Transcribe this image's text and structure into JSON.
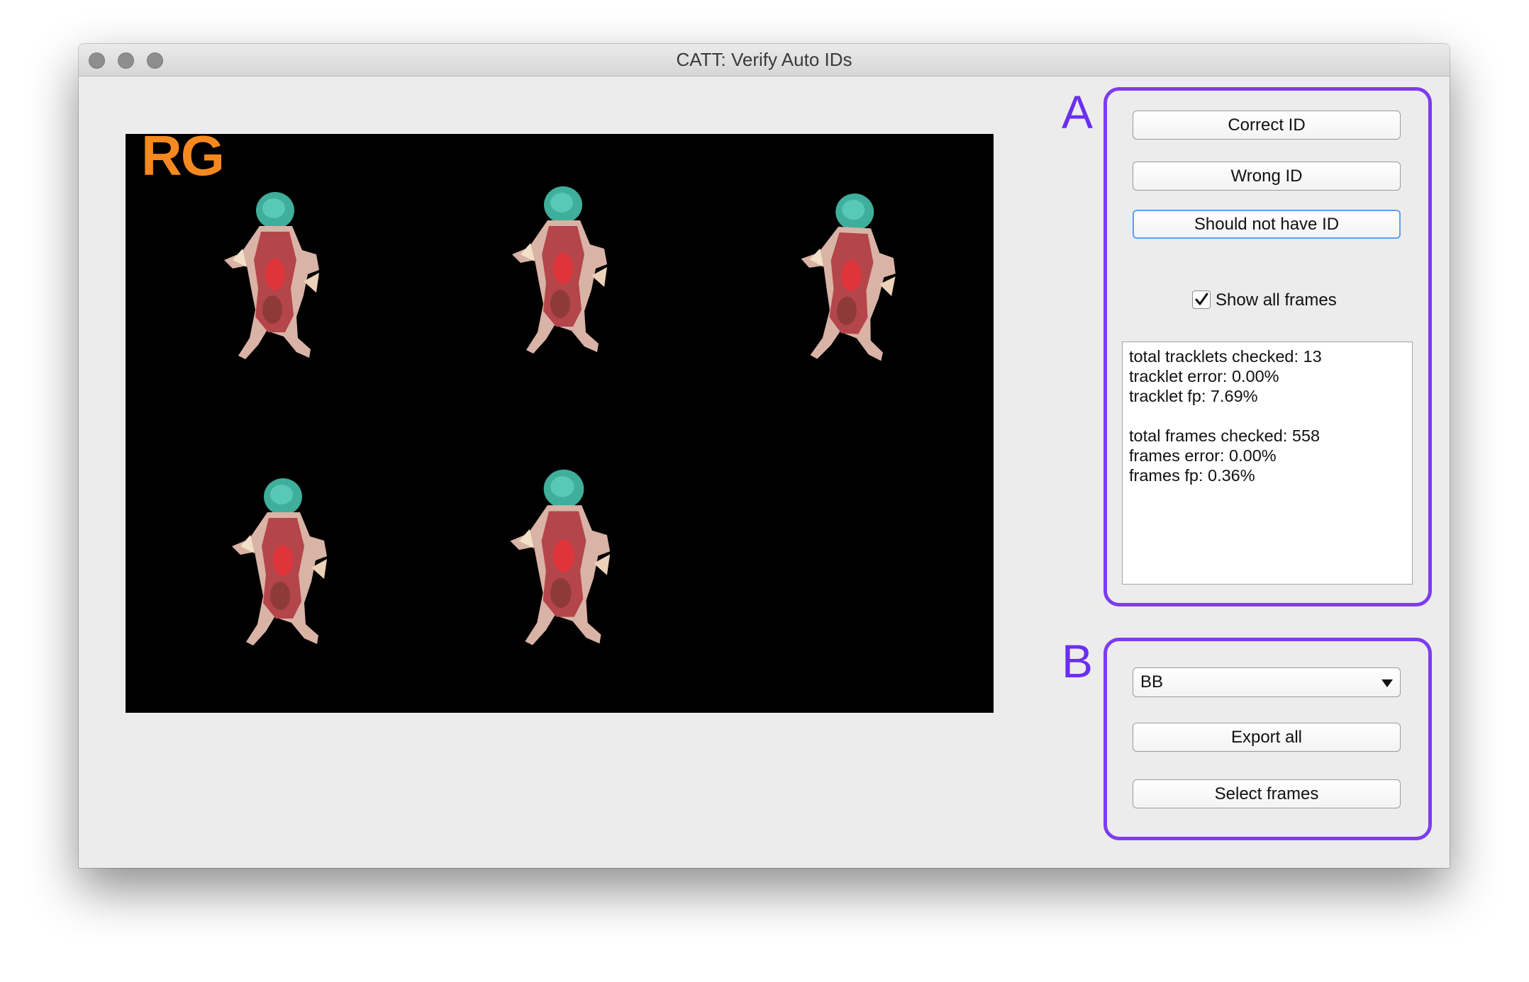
{
  "window": {
    "title": "CATT: Verify Auto IDs"
  },
  "viewer": {
    "label": "RG",
    "label_color": "#f5891f"
  },
  "panel_a": {
    "letter": "A",
    "buttons": {
      "correct": "Correct ID",
      "wrong": "Wrong ID",
      "should_not": "Should not have ID"
    },
    "checkbox": {
      "label": "Show all frames",
      "checked": true
    },
    "stats": {
      "tracklets_checked": "total tracklets checked: 13",
      "tracklet_error": "tracklet error: 0.00%",
      "tracklet_fp": "tracklet fp: 7.69%",
      "frames_checked": "total frames checked: 558",
      "frames_error": "frames error: 0.00%",
      "frames_fp": "frames fp: 0.36%"
    }
  },
  "panel_b": {
    "letter": "B",
    "dropdown": {
      "value": "BB"
    },
    "buttons": {
      "export_all": "Export all",
      "select_frames": "Select frames"
    }
  },
  "colors": {
    "annotation": "#7d3cf0",
    "focus": "#5aa0f7"
  }
}
